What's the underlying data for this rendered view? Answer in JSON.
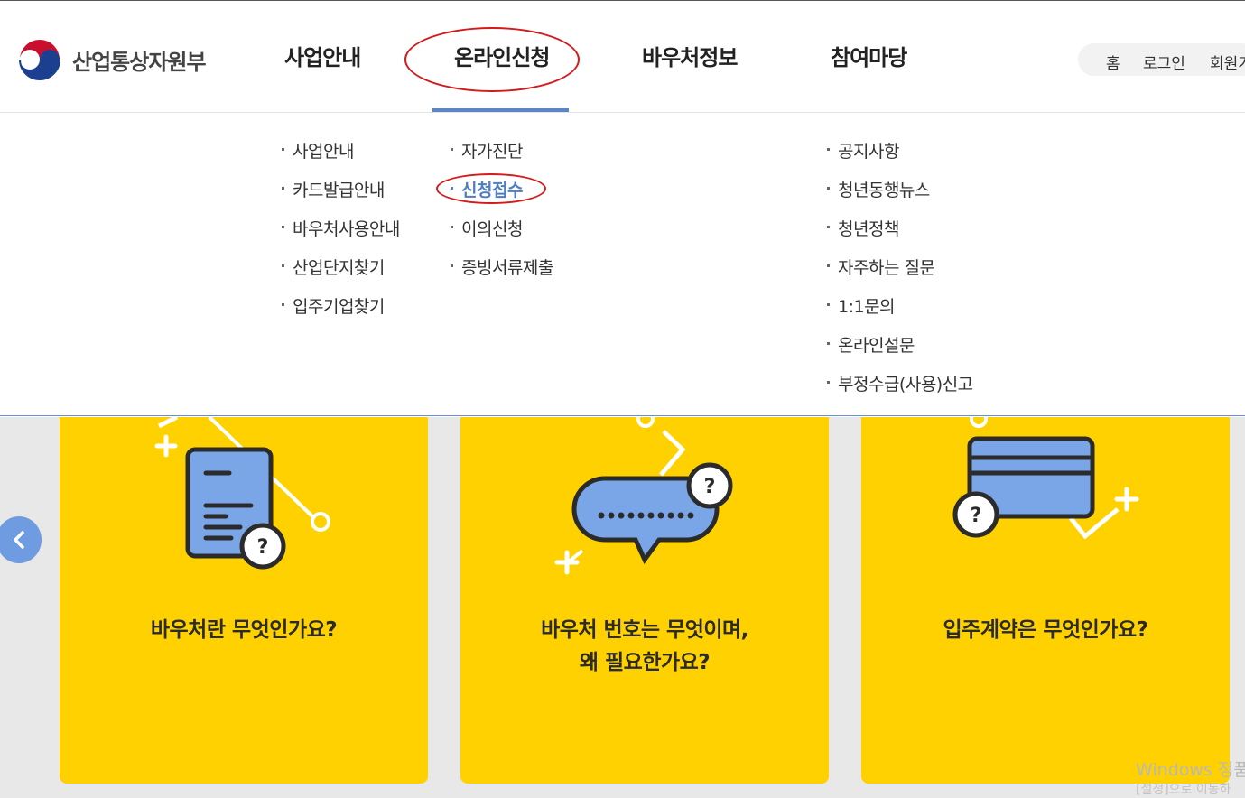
{
  "header": {
    "logo_text": "산업통상자원부",
    "nav": [
      {
        "label": "사업안내"
      },
      {
        "label": "온라인신청"
      },
      {
        "label": "바우처정보"
      },
      {
        "label": "참여마당"
      }
    ],
    "util": {
      "home": "홈",
      "login": "로그인",
      "join": "회원가"
    }
  },
  "mega_menu": {
    "col1": [
      "사업안내",
      "카드발급안내",
      "바우처사용안내",
      "산업단지찾기",
      "입주기업찾기"
    ],
    "col2": [
      "자가진단",
      "신청접수",
      "이의신청",
      "증빙서류제출"
    ],
    "col4": [
      "공지사항",
      "청년동행뉴스",
      "청년정책",
      "자주하는 질문",
      "1:1문의",
      "온라인설문",
      "부정수급(사용)신고"
    ]
  },
  "cards": [
    {
      "title_line1": "바우처란 무엇인가요?",
      "title_line2": ""
    },
    {
      "title_line1": "바우처 번호는 무엇이며,",
      "title_line2": "왜 필요한가요?"
    },
    {
      "title_line1": "입주계약은 무엇인가요?",
      "title_line2": ""
    }
  ],
  "watermark": {
    "line1": "Windows 정품",
    "line2": "[설정]으로 이동하"
  },
  "colors": {
    "accent": "#5b85c6",
    "card": "#ffd100",
    "annotation": "#d21b1b"
  }
}
